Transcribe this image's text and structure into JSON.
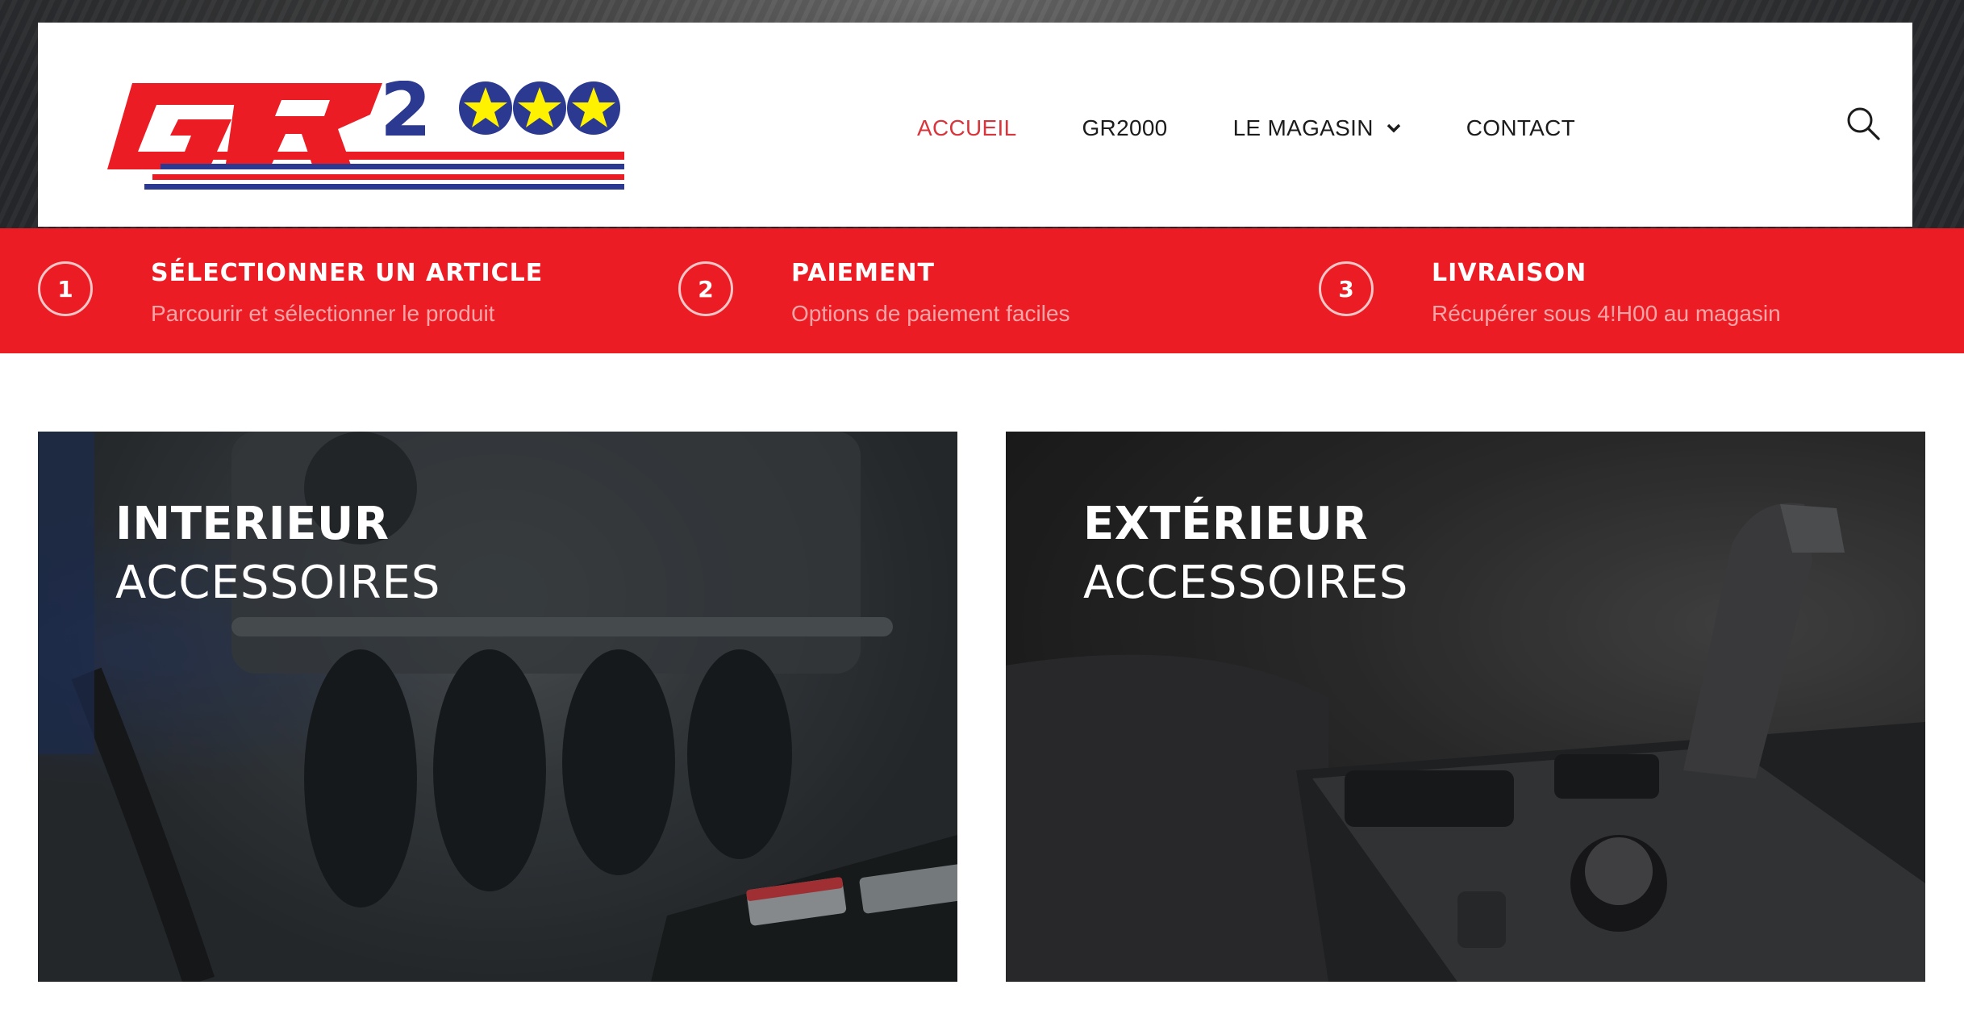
{
  "brand": {
    "logo_text": "GR2000",
    "colors": {
      "red": "#ec1c24",
      "blue": "#2b3990",
      "yellow": "#fff200"
    }
  },
  "nav": {
    "items": [
      {
        "label": "ACCUEIL",
        "active": true
      },
      {
        "label": "GR2000",
        "active": false
      },
      {
        "label": "LE MAGASIN",
        "active": false,
        "has_dropdown": true
      },
      {
        "label": "CONTACT",
        "active": false
      }
    ],
    "active_color": "#d9353c",
    "search_icon": "search-icon"
  },
  "steps": [
    {
      "number": "1",
      "title": "SÉLECTIONNER UN ARTICLE",
      "subtitle": "Parcourir et sélectionner le produit"
    },
    {
      "number": "2",
      "title": "PAIEMENT",
      "subtitle": "Options de paiement faciles"
    },
    {
      "number": "3",
      "title": "LIVRAISON",
      "subtitle": "Récupérer sous 4!H00 au magasin"
    }
  ],
  "categories": [
    {
      "title": "INTERIEUR",
      "subtitle": "ACCESSOIRES"
    },
    {
      "title": "EXTÉRIEUR",
      "subtitle": "ACCESSOIRES"
    }
  ]
}
